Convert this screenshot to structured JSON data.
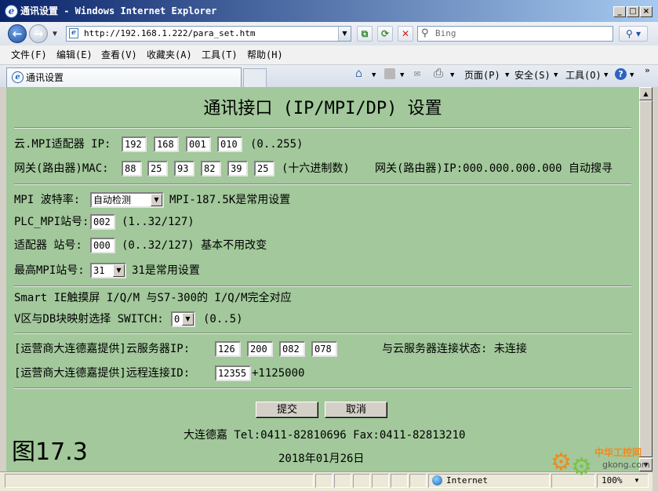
{
  "window": {
    "title": "通讯设置 - Windows Internet Explorer",
    "icon": "ie-icon"
  },
  "address_bar": {
    "url": "http://192.168.1.222/para_set.htm",
    "search_placeholder": "Bing"
  },
  "menu": [
    "文件(F)",
    "编辑(E)",
    "查看(V)",
    "收藏夹(A)",
    "工具(T)",
    "帮助(H)"
  ],
  "tab": {
    "label": "通讯设置"
  },
  "command_bar": {
    "page": "页面(P)",
    "safety": "安全(S)",
    "tools": "工具(O)"
  },
  "page": {
    "title": "通讯接口 (IP/MPI/DP) 设置",
    "adapter_ip": {
      "label": "云.MPI适配器 IP:",
      "values": [
        "192",
        "168",
        "001",
        "010"
      ],
      "hint": "(0..255)"
    },
    "gateway_mac": {
      "label": "网关(路由器)MAC:",
      "values": [
        "88",
        "25",
        "93",
        "82",
        "39",
        "25"
      ],
      "hint": "(十六进制数)",
      "gateway_ip": "网关(路由器)IP:000.000.000.000 自动搜寻"
    },
    "baud": {
      "label": "MPI 波特率:",
      "selected": "自动检测",
      "hint": "MPI-187.5K是常用设置"
    },
    "plc_station": {
      "label": "PLC_MPI站号:",
      "value": "002",
      "hint": "(1..32/127)"
    },
    "adapter_station": {
      "label": "适配器 站号:",
      "value": "000",
      "hint": "(0..32/127) 基本不用改变"
    },
    "max_station": {
      "label": "最高MPI站号:",
      "selected": "31",
      "hint": "31是常用设置"
    },
    "smart_note": "Smart IE触摸屏 I/Q/M 与S7-300的 I/Q/M完全对应",
    "switch": {
      "label": "V区与DB块映射选择 SWITCH:",
      "selected": "0",
      "hint": "(0..5)"
    },
    "server_ip": {
      "label": "[运营商大连德嘉提供]云服务器IP:",
      "values": [
        "126",
        "200",
        "082",
        "078"
      ],
      "status": "与云服务器连接状态: 未连接"
    },
    "remote_id": {
      "label": "[运营商大连德嘉提供]远程连接ID:",
      "value": "12355",
      "suffix": "+1125000"
    },
    "buttons": {
      "submit": "提交",
      "cancel": "取消"
    },
    "contact": "大连德嘉 Tel:0411-82810696 Fax:0411-82813210",
    "date": "2018年01月26日"
  },
  "figure_label": "图17.3",
  "status_bar": {
    "zone": "Internet",
    "zoom": "100%"
  },
  "watermark": {
    "name": "中华工控网",
    "domain": "gkong.com"
  },
  "colors": {
    "content_bg": "#a2c89b",
    "titlebar_start": "#0a246a",
    "titlebar_end": "#a6caf0",
    "watermark_orange": "#f08a1c",
    "watermark_green": "#7cc242"
  }
}
